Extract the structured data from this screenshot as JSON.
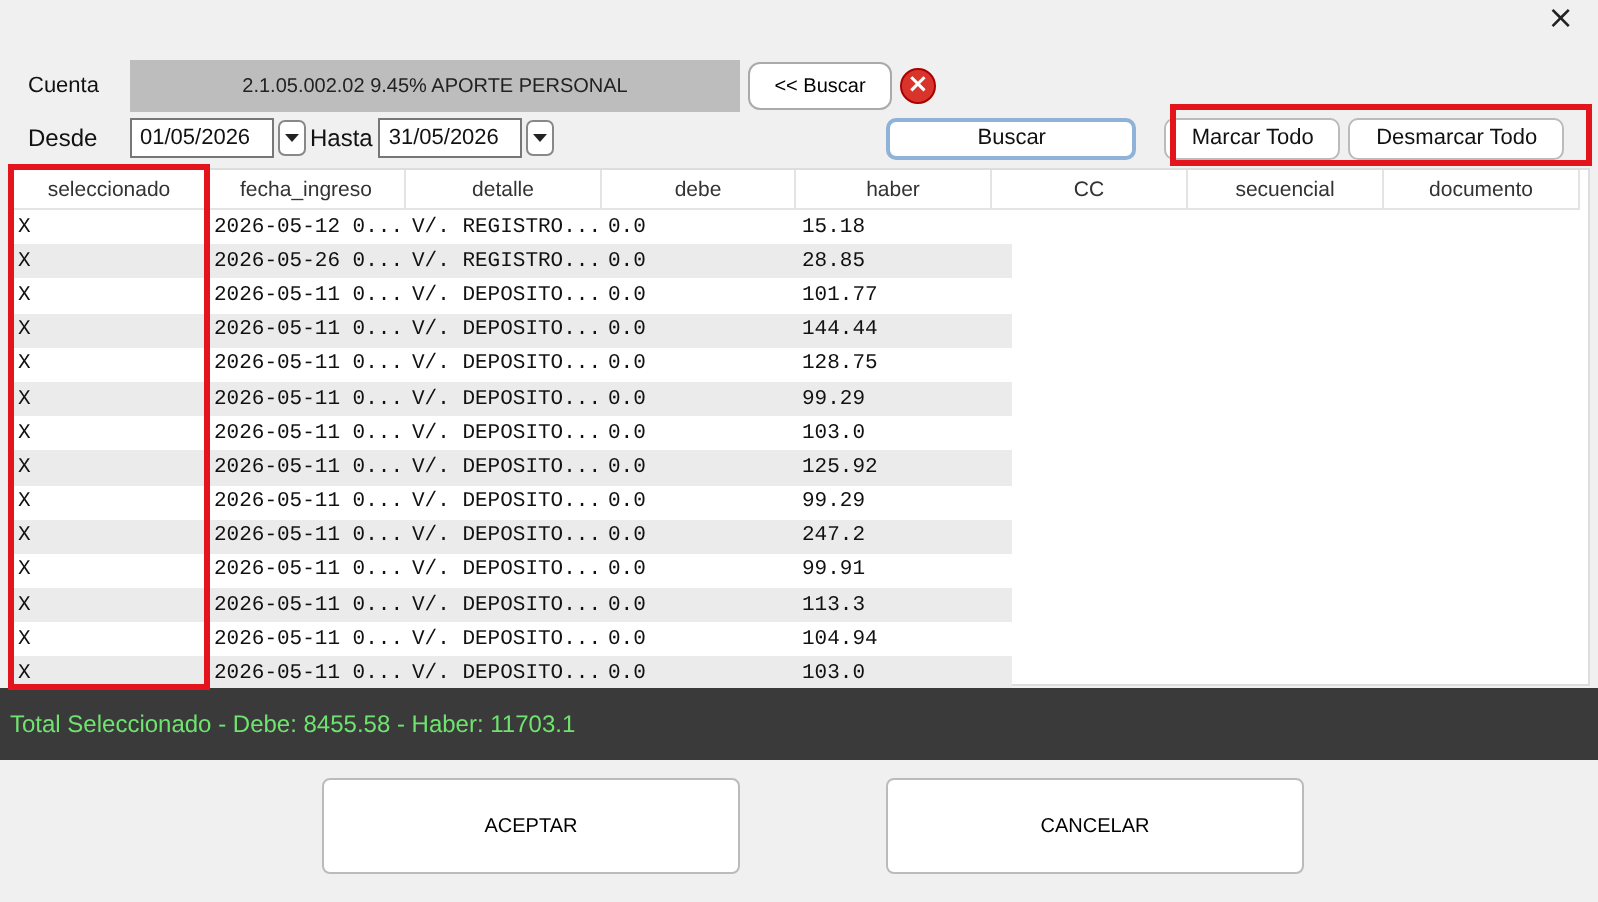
{
  "window": {
    "close": "×"
  },
  "cuenta": {
    "label": "Cuenta",
    "value": "2.1.05.002.02  9.45% APORTE PERSONAL",
    "search_button": "<< Buscar",
    "clear": "×"
  },
  "range": {
    "from_label": "Desde",
    "from": "01/05/2026",
    "to_label": "Hasta",
    "to": "31/05/2026"
  },
  "buttons": {
    "search": "Buscar",
    "mark_all": "Marcar Todo",
    "unmark_all": "Desmarcar Todo"
  },
  "table": {
    "columns": [
      "seleccionado",
      "fecha_ingreso",
      "detalle",
      "debe",
      "haber",
      "CC",
      "secuencial",
      "documento"
    ],
    "rows": [
      [
        "X",
        "2026-05-12 0...",
        "V/. REGISTRO...",
        "0.0",
        "15.18"
      ],
      [
        "X",
        "2026-05-26 0...",
        "V/. REGISTRO...",
        "0.0",
        "28.85"
      ],
      [
        "X",
        "2026-05-11 0...",
        "V/. DEPOSITO...",
        "0.0",
        "101.77"
      ],
      [
        "X",
        "2026-05-11 0...",
        "V/. DEPOSITO...",
        "0.0",
        "144.44"
      ],
      [
        "X",
        "2026-05-11 0...",
        "V/. DEPOSITO...",
        "0.0",
        "128.75"
      ],
      [
        "X",
        "2026-05-11 0...",
        "V/. DEPOSITO...",
        "0.0",
        "99.29"
      ],
      [
        "X",
        "2026-05-11 0...",
        "V/. DEPOSITO...",
        "0.0",
        "103.0"
      ],
      [
        "X",
        "2026-05-11 0...",
        "V/. DEPOSITO...",
        "0.0",
        "125.92"
      ],
      [
        "X",
        "2026-05-11 0...",
        "V/. DEPOSITO...",
        "0.0",
        "99.29"
      ],
      [
        "X",
        "2026-05-11 0...",
        "V/. DEPOSITO...",
        "0.0",
        "247.2"
      ],
      [
        "X",
        "2026-05-11 0...",
        "V/. DEPOSITO...",
        "0.0",
        "99.91"
      ],
      [
        "X",
        "2026-05-11 0...",
        "V/. DEPOSITO...",
        "0.0",
        "113.3"
      ],
      [
        "X",
        "2026-05-11 0...",
        "V/. DEPOSITO...",
        "0.0",
        "104.94"
      ],
      [
        "X",
        "2026-05-11 0...",
        "V/. DEPOSITO...",
        "0.0",
        "103.0"
      ]
    ]
  },
  "status": "Total Seleccionado - Debe: 8455.58 - Haber: 11703.1",
  "actions": [
    "ACEPTAR",
    "CANCELAR"
  ]
}
